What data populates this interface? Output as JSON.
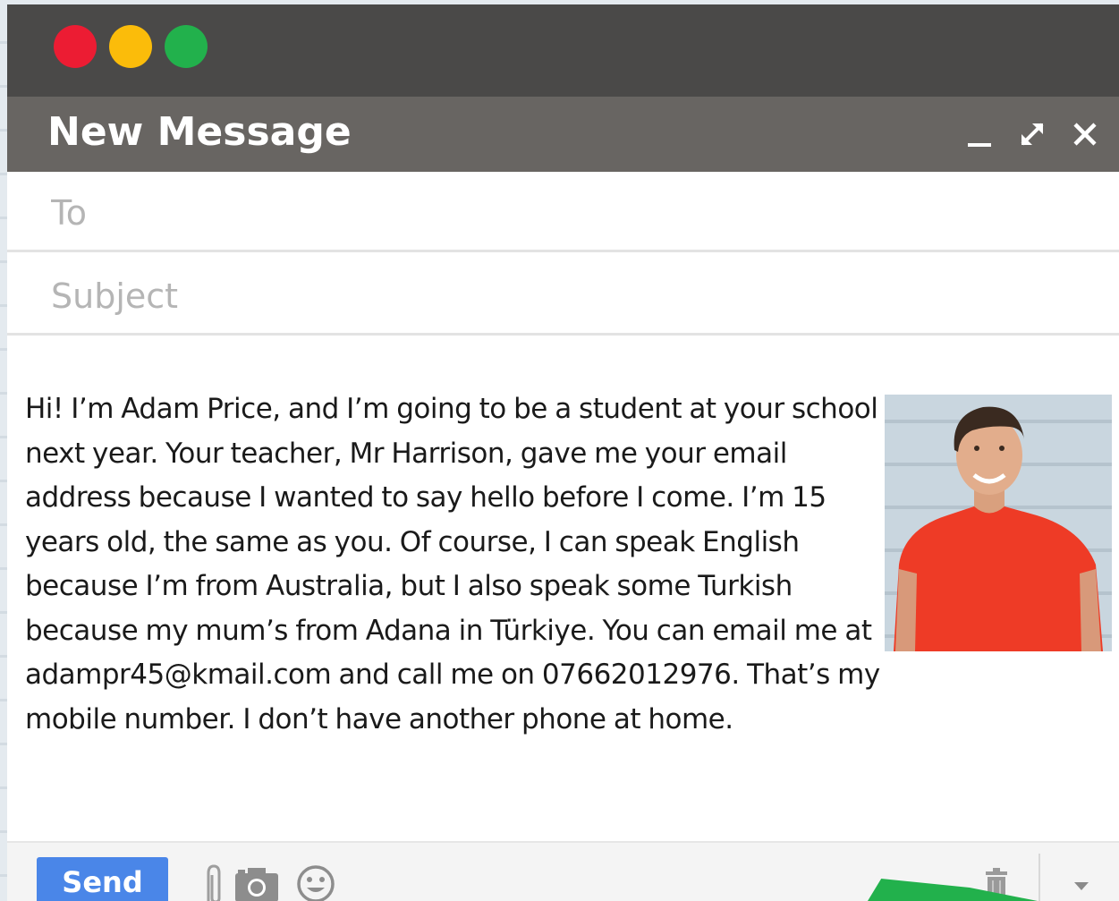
{
  "window": {
    "title": "New Message",
    "traffic_lights": [
      "#ec1c33",
      "#fbbc0a",
      "#22b14c"
    ],
    "controls": [
      "minimize-icon",
      "expand-icon",
      "close-icon"
    ]
  },
  "form": {
    "to_placeholder": "To",
    "subject_placeholder": "Subject"
  },
  "message": {
    "body": "Hi! I’m Adam Price, and I’m going to be a student at your school next year. Your teacher, Mr Harrison, gave me your email address because I wanted to say hello before I come. I’m 15 years old, the same as you. Of course, I can speak English because I’m from Australia, but I also speak some Turkish because my mum’s from Adana in Türkiye. You can email me at adampr45@kmail.com and call me on 07662012976. That’s my mobile number. I don’t have another phone at home."
  },
  "toolbar": {
    "send_label": "Send",
    "send_color": "#4a86e8",
    "icons": [
      "paperclip-icon",
      "camera-icon",
      "smiley-icon",
      "trash-icon",
      "chevron-down-icon"
    ]
  }
}
